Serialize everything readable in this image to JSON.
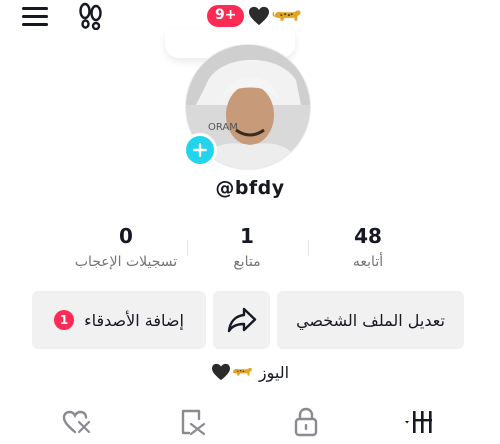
{
  "header": {
    "notification_count": "9+",
    "icons": [
      "menu-icon",
      "footprint-icon",
      "black-heart-icon",
      "leopard-icon"
    ]
  },
  "profile": {
    "username": "@bfdy",
    "avatar_watermark": "ORAM"
  },
  "stats": [
    {
      "value": "48",
      "label": "أتابعه"
    },
    {
      "value": "1",
      "label": "متابع"
    },
    {
      "value": "0",
      "label": "تسجيلات الإعجاب"
    }
  ],
  "actions": {
    "edit_profile": "تعديل الملف الشخصي",
    "add_friends": "إضافة الأصدقاء",
    "add_friends_count": "1"
  },
  "bio": {
    "text": "اليوز"
  },
  "tabs": [
    "videos-grid-icon",
    "lock-icon",
    "reposts-icon",
    "liked-icon"
  ],
  "colors": {
    "accent": "#fe2c55",
    "avatar_add": "#20d5ec",
    "button_bg": "#f1f1f2",
    "text": "#161823",
    "muted": "#757575"
  }
}
